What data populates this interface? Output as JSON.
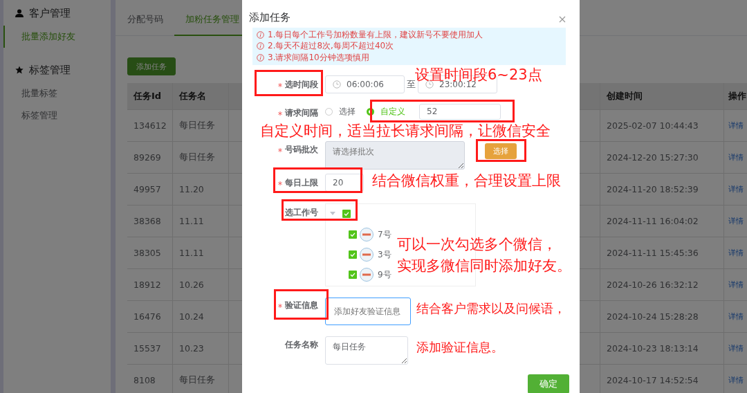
{
  "sidebar": {
    "groups": [
      {
        "title": "客户管理",
        "items": [
          {
            "label": "批量添加好友",
            "selected": true
          }
        ]
      },
      {
        "title": "标签管理",
        "items": [
          {
            "label": "批量标签",
            "selected": false
          },
          {
            "label": "标签管理",
            "selected": false
          }
        ]
      }
    ]
  },
  "tabs": [
    {
      "label": "分配号码",
      "selected": false
    },
    {
      "label": "加粉任务管理",
      "selected": true
    }
  ],
  "add_button": "添加任务",
  "table": {
    "columns": [
      "任务Id",
      "任务名",
      "创建时间",
      "操作"
    ],
    "rows": [
      {
        "id": "134612",
        "name": "每日任务",
        "created": "2025-02-07 10:44:43",
        "action": "详情"
      },
      {
        "id": "89269",
        "name": "每日任务",
        "created": "2024-12-20 15:27:30",
        "action": "详情"
      },
      {
        "id": "49957",
        "name": "11.20",
        "created": "2024-11-20 18:52:39",
        "action": "详情"
      },
      {
        "id": "38368",
        "name": "11.11",
        "created": "2024-11-11 16:04:02",
        "action": "详情"
      },
      {
        "id": "38305",
        "name": "11.11",
        "created": "2024-11-11 15:45:36",
        "action": "详情"
      },
      {
        "id": "18912",
        "name": "10.26",
        "created": "2024-10-26 16:32:12",
        "action": "详情"
      },
      {
        "id": "16476",
        "name": "10.24",
        "created": "2024-10-24 15:28:28",
        "action": "详情"
      },
      {
        "id": "15537",
        "name": "10.23",
        "created": "2024-10-23 18:13:14",
        "action": "详情"
      },
      {
        "id": "8108",
        "name": "每日任务",
        "created": "2024-10-17 14:52:54",
        "action": "详情"
      }
    ]
  },
  "modal": {
    "title": "添加任务",
    "notices": [
      "1.每日每个工作号加粉数量有上限，建议新号不要使用加人",
      "2.每天不超过8次,每周不超过40次",
      "3.请求间隔10分钟选项慎用"
    ],
    "time_range": {
      "label": "选时间段",
      "required": true,
      "start": "06:00:06",
      "separator": "至",
      "end": "23:00:12"
    },
    "interval": {
      "label": "请求间隔",
      "required": true,
      "options": [
        {
          "label": "选择",
          "selected": false
        },
        {
          "label": "自定义",
          "selected": true
        }
      ],
      "value": "52"
    },
    "batch": {
      "label": "号码批次",
      "required": true,
      "placeholder": "请选择批次",
      "disabled": true,
      "button": "选择"
    },
    "daily_limit": {
      "label": "每日上限",
      "required": true,
      "value": "20"
    },
    "accounts": {
      "label": "选工作号",
      "required": false,
      "checked": true,
      "expanded": true,
      "children": [
        {
          "label": "7号",
          "checked": true
        },
        {
          "label": "3号",
          "checked": true
        },
        {
          "label": "9号",
          "checked": true
        }
      ]
    },
    "verify": {
      "label": "验证信息",
      "required": true,
      "placeholder": "添加好友验证信息",
      "focused": true
    },
    "task_name": {
      "label": "任务名称",
      "required": false,
      "value": "每日任务"
    },
    "confirm": "确定"
  },
  "annotations": [
    {
      "text": "设置时间段6~23点"
    },
    {
      "text": "自定义时间，适当拉长请求间隔，让微信安全"
    },
    {
      "text": "结合微信权重，合理设置上限"
    },
    {
      "text": "可以一次勾选多个微信，"
    },
    {
      "text": "实现多微信同时添加好友。"
    },
    {
      "text": "结合客户需求以及问候语，"
    },
    {
      "text": "添加验证信息。"
    }
  ]
}
